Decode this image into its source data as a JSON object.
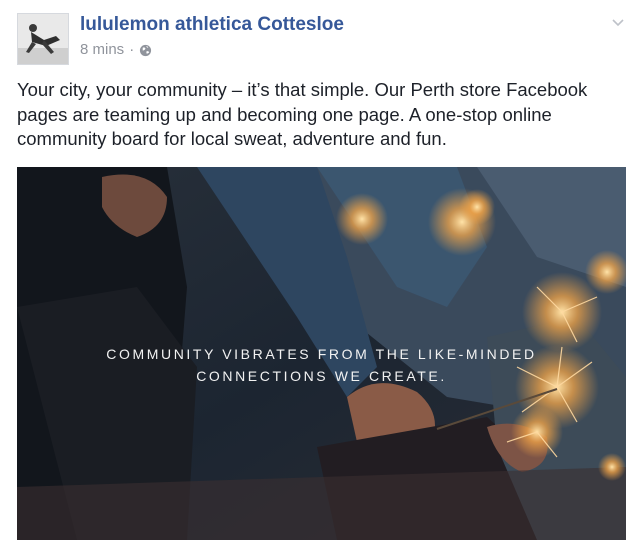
{
  "post": {
    "page_name": "lululemon athletica Cottesloe",
    "timestamp": "8 mins",
    "separator": "·",
    "privacy_icon": "globe-icon",
    "menu_icon": "chevron-down-icon",
    "text": "Your city, your community – it’s that simple. Our Perth store Facebook pages are teaming up and becoming one page. A one-stop online community board for local sweat, adventure and fun.",
    "link_color": "#365899",
    "meta_color": "#90949c"
  },
  "photo": {
    "overlay_line_1": "COMMUNITY VIBRATES FROM THE LIKE-MINDED",
    "overlay_line_2": "CONNECTIONS WE CREATE."
  }
}
